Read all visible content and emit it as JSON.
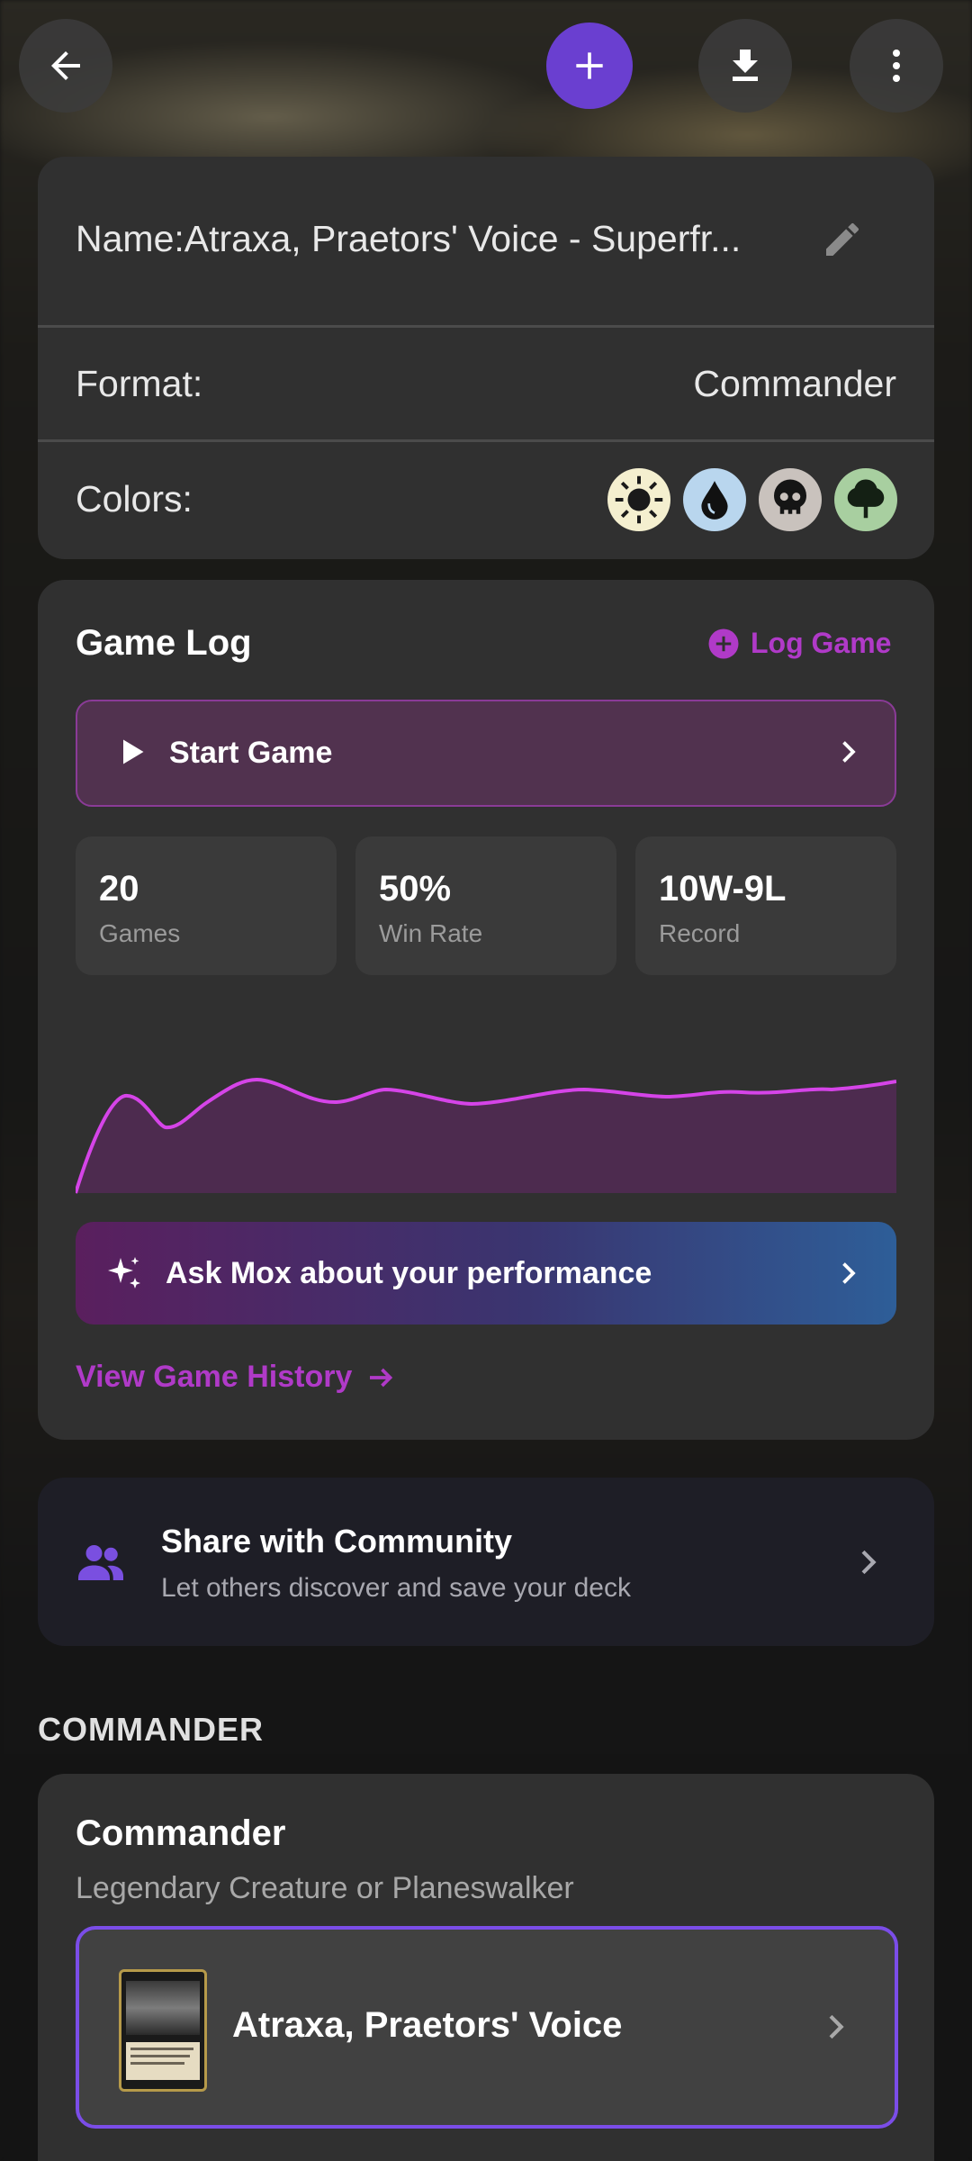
{
  "header": {
    "back_icon": "arrow-left-icon",
    "add_icon": "plus-icon",
    "download_icon": "download-icon",
    "more_icon": "more-vertical-icon",
    "accent": "#6a3fd0"
  },
  "deck_info": {
    "name_label": "Name:Atraxa, Praetors' Voice - Superfr...",
    "edit_icon": "pencil-icon",
    "format_label": "Format:",
    "format_value": "Commander",
    "colors_label": "Colors:",
    "colors": [
      {
        "name": "white",
        "icon": "sun-icon",
        "color": "#f4efcf"
      },
      {
        "name": "blue",
        "icon": "water-drop-icon",
        "color": "#b9d6ee"
      },
      {
        "name": "black",
        "icon": "skull-icon",
        "color": "#c9c2bd"
      },
      {
        "name": "green",
        "icon": "tree-icon",
        "color": "#a8cfa0"
      }
    ]
  },
  "game_log": {
    "title": "Game Log",
    "log_game_label": "Log Game",
    "start_game_label": "Start Game",
    "stats": [
      {
        "value": "20",
        "label": "Games"
      },
      {
        "value": "50%",
        "label": "Win Rate"
      },
      {
        "value": "10W-9L",
        "label": "Record"
      }
    ],
    "ask_mox_label": "Ask Mox about your performance",
    "view_history_label": "View Game History",
    "accent": "#b03ac8",
    "line_color": "#d544e8"
  },
  "share": {
    "title": "Share with Community",
    "subtitle": "Let others discover and save your deck",
    "icon": "people-icon"
  },
  "commander_section": {
    "heading": "COMMANDER",
    "card_title": "Commander",
    "card_subtitle": "Legendary Creature or Planeswalker",
    "commander_name": "Atraxa, Praetors' Voice"
  }
}
